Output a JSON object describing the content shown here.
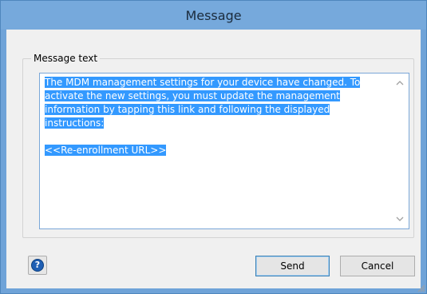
{
  "window": {
    "title": "Message"
  },
  "group": {
    "legend": "Message text"
  },
  "message": {
    "lines": [
      "The MDM management settings for your device have changed. To",
      "activate the new settings, you must update the management",
      "information by tapping this link and following the displayed",
      "instructions:",
      "",
      "<<Re-enrollment URL>>"
    ]
  },
  "buttons": {
    "help_icon": "help-icon",
    "send_label": "Send",
    "cancel_label": "Cancel"
  },
  "colors": {
    "titlebar": "#76a9dc",
    "selection": "#3399ff",
    "client": "#f0f0f0"
  }
}
